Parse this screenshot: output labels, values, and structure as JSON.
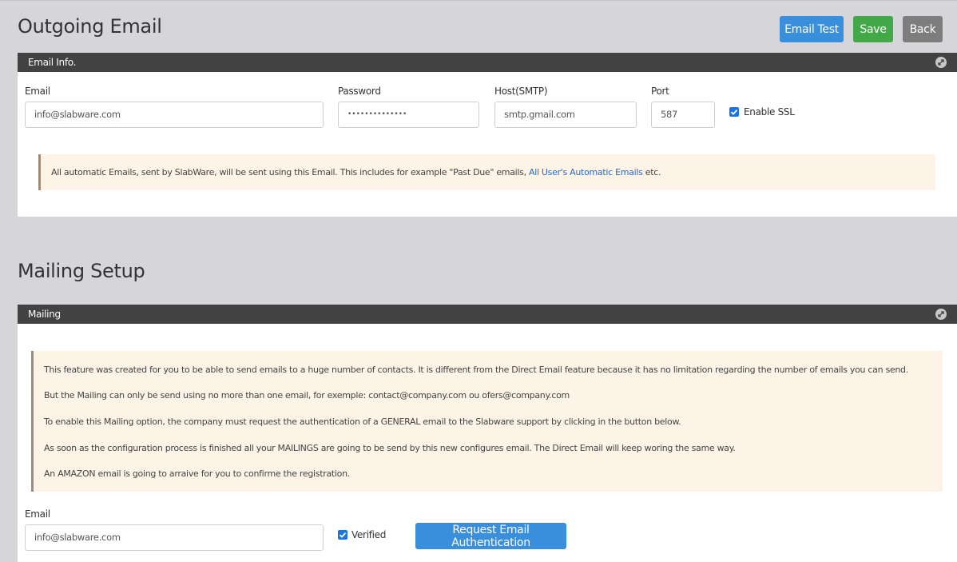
{
  "outgoing": {
    "title": "Outgoing Email",
    "buttons": {
      "email_test": "Email Test",
      "save": "Save",
      "back": "Back"
    },
    "panel_title": "Email Info.",
    "email_label": "Email",
    "email_value": "info@slabware.com",
    "password_label": "Password",
    "password_value": "••••••••••••••",
    "host_label": "Host(SMTP)",
    "host_value": "smtp.gmail.com",
    "port_label": "Port",
    "port_value": "587",
    "ssl_label": "Enable SSL",
    "ssl_checked": true,
    "notice_text": "All automatic Emails, sent by SlabWare, will be sent using this Email. This includes for example \"Past Due\" emails, ",
    "notice_link": "All User's Automatic Emails",
    "notice_suffix": " etc."
  },
  "mailing": {
    "title": "Mailing Setup",
    "panel_title": "Mailing",
    "notice_lines": [
      "This feature was created for you to be able to send emails to a huge number of contacts. It is different from the Direct Email feature because it has no limitation regarding the number of emails you can send.",
      "But the Mailing can only be send using no more than one email, for exemple: contact@company.com ou ofers@company.com",
      "To enable this Mailing option, the company must request the authentication of a GENERAL email to the Slabware support by clicking in the button below.",
      "As soon as the configuration process is finished all your MAILINGS are going to be send by this new configures email. The Direct Email will keep woring the same way.",
      "An AMAZON email is going to arraive for you to confirme the registration."
    ],
    "email_label": "Email",
    "email_value": "info@slabware.com",
    "verified_label": "Verified",
    "verified_checked": true,
    "request_button": "Request Email Authentication"
  },
  "colors": {
    "primary": "#3a8fdd",
    "success": "#43a848",
    "secondary": "#7d7d7d",
    "panel_header": "#424242",
    "notice_bg": "#fdf3e6"
  }
}
